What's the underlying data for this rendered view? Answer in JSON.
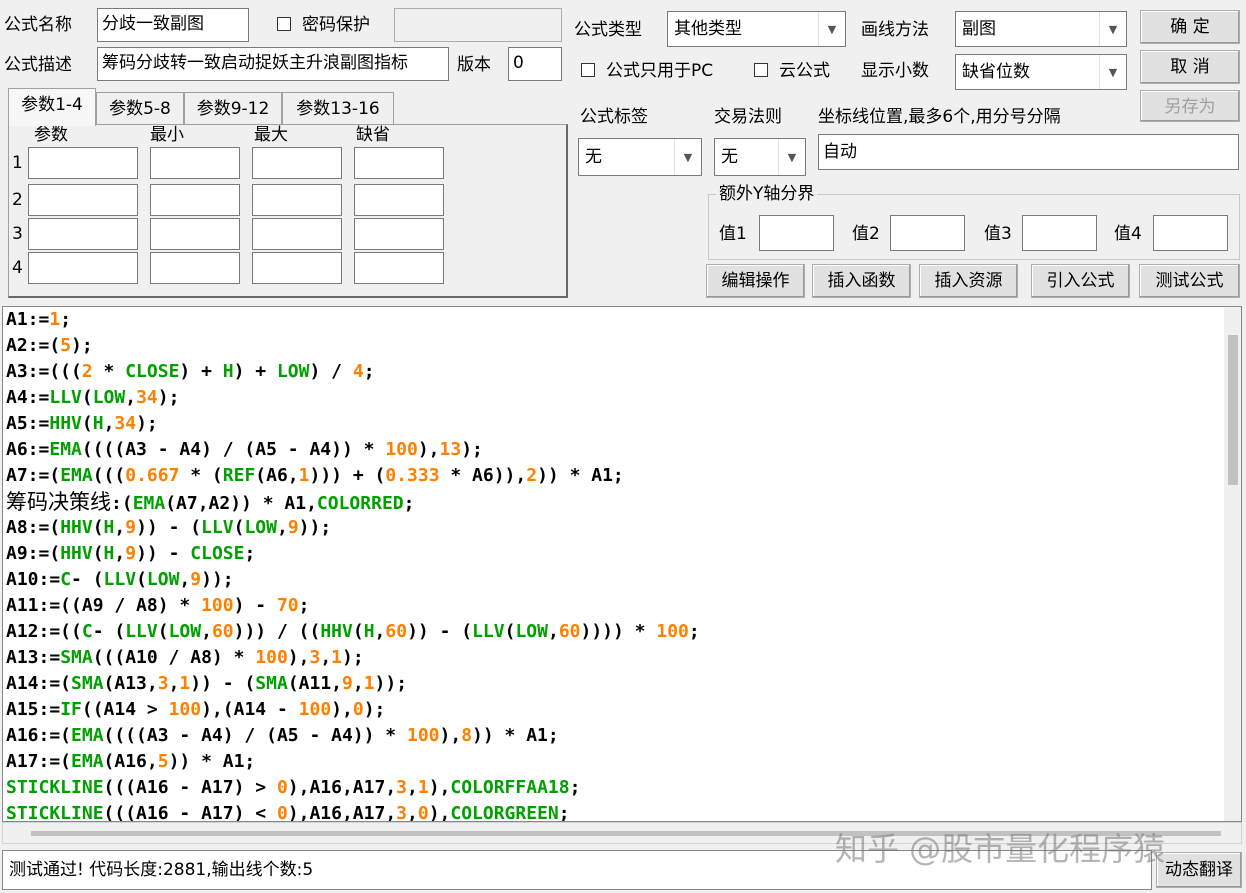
{
  "form": {
    "name_label": "公式名称",
    "name_value": "分歧一致副图",
    "password_label": "密码保护",
    "password_value": "",
    "desc_label": "公式描述",
    "desc_value": "筹码分歧转一致启动捉妖主升浪副图指标",
    "version_label": "版本",
    "version_value": "0",
    "type_label": "公式类型",
    "type_value": "其他类型",
    "draw_label": "画线方法",
    "draw_value": "副图",
    "pc_only_label": "公式只用于PC",
    "cloud_label": "云公式",
    "decimals_label": "显示小数",
    "decimals_value": "缺省位数",
    "tag_label": "公式标签",
    "tag_value": "无",
    "trade_label": "交易法则",
    "trade_value": "无",
    "axis_label": "坐标线位置,最多6个,用分号分隔",
    "axis_value": "自动",
    "ybound_title": "额外Y轴分界",
    "ybound_labels": [
      "值1",
      "值2",
      "值3",
      "值4"
    ]
  },
  "buttons": {
    "ok": "确 定",
    "cancel": "取 消",
    "save_as": "另存为",
    "edit": "编辑操作",
    "insert_func": "插入函数",
    "insert_res": "插入资源",
    "import": "引入公式",
    "test": "测试公式",
    "translate": "动态翻译"
  },
  "tabs": [
    "参数1-4",
    "参数5-8",
    "参数9-12",
    "参数13-16"
  ],
  "params": {
    "headers": [
      "参数",
      "最小",
      "最大",
      "缺省"
    ],
    "rows": [
      "1",
      "2",
      "3",
      "4"
    ]
  },
  "code_lines": [
    "A1:=1;",
    "A2:=(5);",
    "A3:=(((2 * CLOSE) + H) + LOW) / 4;",
    "A4:=LLV(LOW,34);",
    "A5:=HHV(H,34);",
    "A6:=EMA((((A3 - A4) / (A5 - A4)) * 100),13);",
    "A7:=(EMA(((0.667 * (REF(A6,1))) + (0.333 * A6)),2)) * A1;",
    "筹码决策线:(EMA(A7,A2)) * A1,COLORRED;",
    "A8:=(HHV(H,9)) - (LLV(LOW,9));",
    "A9:=(HHV(H,9)) - CLOSE;",
    "A10:=C- (LLV(LOW,9));",
    "A11:=((A9 / A8) * 100) - 70;",
    "A12:=((C- (LLV(LOW,60))) / ((HHV(H,60)) - (LLV(LOW,60)))) * 100;",
    "A13:=SMA(((A10 / A8) * 100),3,1);",
    "A14:=(SMA(A13,3,1)) - (SMA(A11,9,1));",
    "A15:=IF((A14 > 100),(A14 - 100),0);",
    "A16:=(EMA((((A3 - A4) / (A5 - A4)) * 100),8)) * A1;",
    "A17:=(EMA(A16,5)) * A1;",
    "STICKLINE(((A16 - A17) > 0),A16,A17,3,1),COLORFFAA18;",
    "STICKLINE(((A16 - A17) < 0),A16,A17,3,0),COLORGREEN;"
  ],
  "status_text": "测试通过! 代码长度:2881,输出线个数:5",
  "watermark": "知乎 @股市量化程序猿",
  "colors": {
    "number": "#ff7f00",
    "function": "#00a000"
  }
}
